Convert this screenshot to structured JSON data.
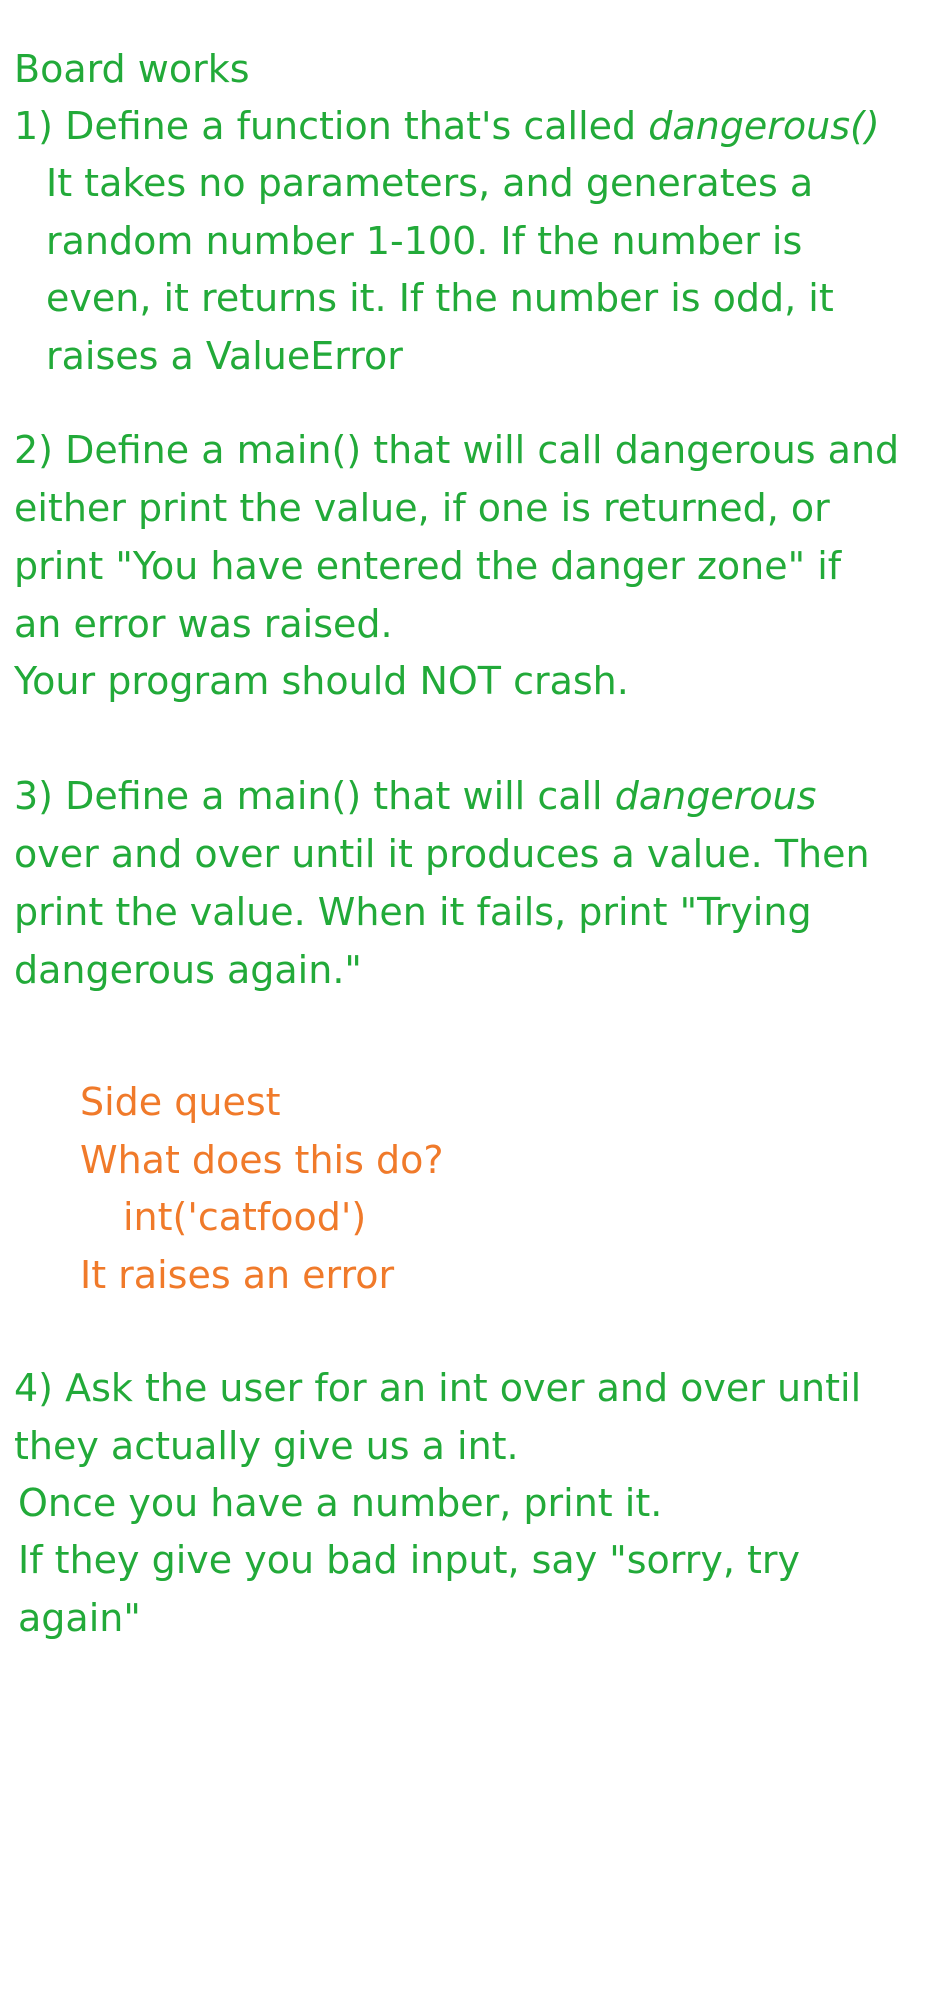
{
  "colors": {
    "main_text": "#22aa39",
    "side_quest_text": "#f07a2a",
    "background": "#ffffff"
  },
  "heading": "Board works",
  "task1": {
    "line1_prefix": "1) Define a function that's called ",
    "line1_name": "dangerous()",
    "line2": "It takes no parameters, and generates a",
    "line3": "random number 1-100. If the number is",
    "line4": "even, it returns it. If the number is odd, it",
    "line5": "raises a ValueError"
  },
  "task2": {
    "line1": "2) Define a main() that will call dangerous and",
    "line2": "either print the value, if one is returned, or",
    "line3": "print \"You have entered the danger zone\" if",
    "line4": "an error was raised.",
    "line5": "Your program should NOT crash."
  },
  "task3": {
    "line1_prefix": "3) Define a main() that will call ",
    "line1_name": "dangerous",
    "line2": "over and over until it produces a value. Then",
    "line3": "print the value. When it fails, print \"Trying",
    "line4": "dangerous again.\""
  },
  "side_quest": {
    "title": "Side quest",
    "question": "What does this do?",
    "code": "int('catfood')",
    "answer": "It raises an error"
  },
  "task4": {
    "line1": "4) Ask the user for an int over and over until",
    "line2": "they actually give us a int.",
    "line3": "Once you have a number, print it.",
    "line4": "If they give you bad input, say \"sorry, try",
    "line5": "again\""
  }
}
